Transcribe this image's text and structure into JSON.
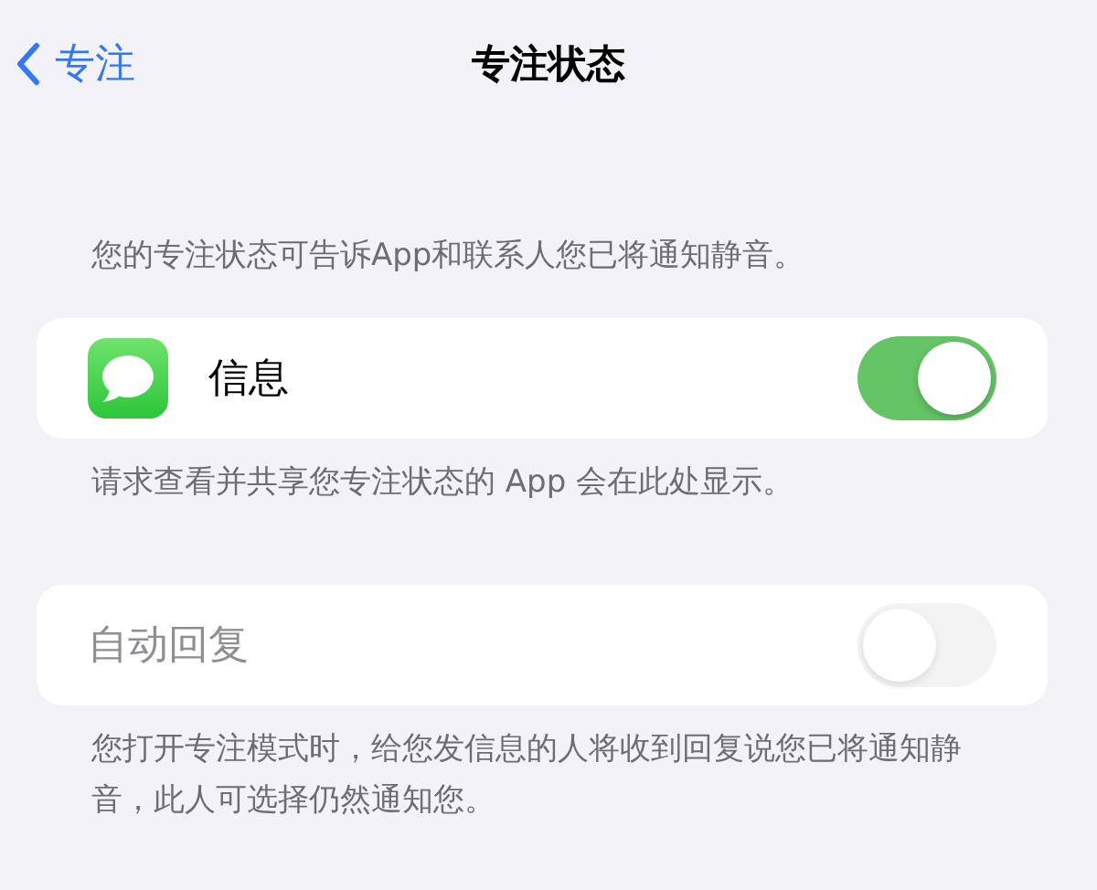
{
  "nav": {
    "back_label": "专注",
    "title": "专注状态"
  },
  "description": "您的专注状态可告诉App和联系人您已将通知静音。",
  "sections": [
    {
      "rows": [
        {
          "kind": "app",
          "label": "信息",
          "on": true,
          "disabled": false
        }
      ],
      "footer": "请求查看并共享您专注状态的 App 会在此处显示。"
    },
    {
      "rows": [
        {
          "kind": "plain",
          "label": "自动回复",
          "on": false,
          "disabled": true
        }
      ],
      "footer": "您打开专注模式时，给您发信息的人将收到回复说您已将通知静音，此人可选择仍然通知您。"
    }
  ]
}
